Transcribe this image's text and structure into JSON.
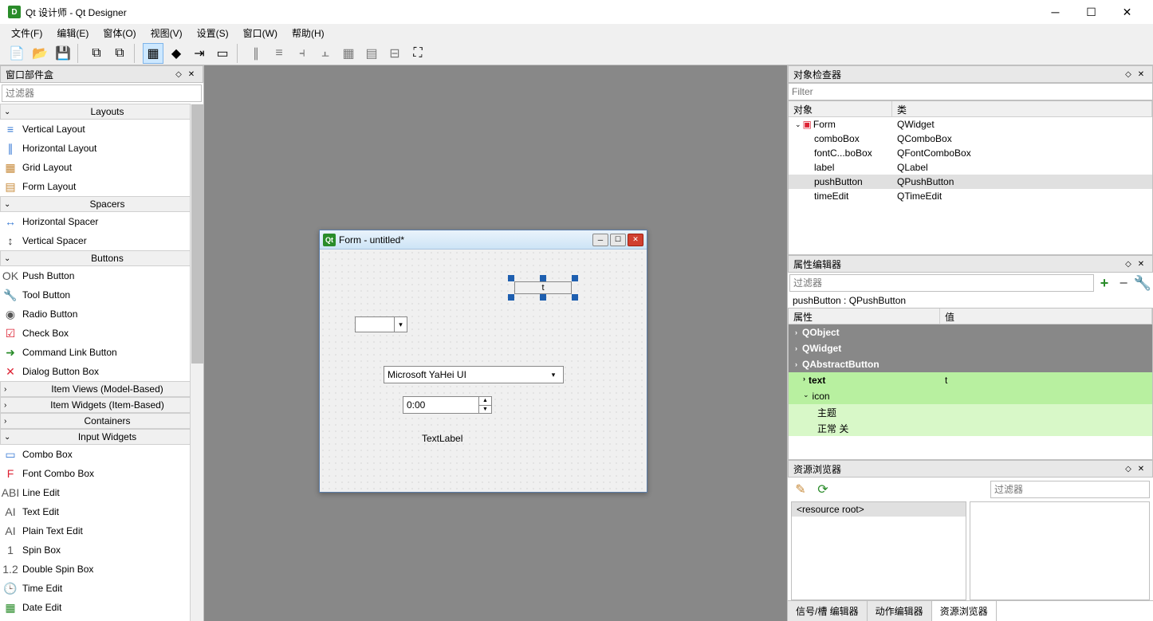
{
  "window": {
    "title": "Qt 设计师 - Qt Designer",
    "app_icon_letter": "D"
  },
  "menus": [
    "文件(F)",
    "编辑(E)",
    "窗体(O)",
    "视图(V)",
    "设置(S)",
    "窗口(W)",
    "帮助(H)"
  ],
  "widget_box": {
    "title": "窗口部件盒",
    "filter_placeholder": "过滤器",
    "groups": [
      {
        "name": "Layouts",
        "expanded": true,
        "items": [
          {
            "label": "Vertical Layout",
            "icon": "≡",
            "color": "#3a7bd5"
          },
          {
            "label": "Horizontal Layout",
            "icon": "∥",
            "color": "#3a7bd5"
          },
          {
            "label": "Grid Layout",
            "icon": "▦",
            "color": "#c78a3a"
          },
          {
            "label": "Form Layout",
            "icon": "▤",
            "color": "#c78a3a"
          }
        ]
      },
      {
        "name": "Spacers",
        "expanded": true,
        "items": [
          {
            "label": "Horizontal Spacer",
            "icon": "↔",
            "color": "#3a7bd5"
          },
          {
            "label": "Vertical Spacer",
            "icon": "↕",
            "color": "#333"
          }
        ]
      },
      {
        "name": "Buttons",
        "expanded": true,
        "items": [
          {
            "label": "Push Button",
            "icon": "OK",
            "color": "#555"
          },
          {
            "label": "Tool Button",
            "icon": "🔧",
            "color": "#555"
          },
          {
            "label": "Radio Button",
            "icon": "◉",
            "color": "#555"
          },
          {
            "label": "Check Box",
            "icon": "☑",
            "color": "#d23"
          },
          {
            "label": "Command Link Button",
            "icon": "➜",
            "color": "#2a8c2a"
          },
          {
            "label": "Dialog Button Box",
            "icon": "✕",
            "color": "#d23"
          }
        ]
      },
      {
        "name": "Item Views (Model-Based)",
        "expanded": false,
        "items": []
      },
      {
        "name": "Item Widgets (Item-Based)",
        "expanded": false,
        "items": []
      },
      {
        "name": "Containers",
        "expanded": false,
        "items": []
      },
      {
        "name": "Input Widgets",
        "expanded": true,
        "items": [
          {
            "label": "Combo Box",
            "icon": "▭",
            "color": "#3a7bd5"
          },
          {
            "label": "Font Combo Box",
            "icon": "F",
            "color": "#d23"
          },
          {
            "label": "Line Edit",
            "icon": "ABI",
            "color": "#555"
          },
          {
            "label": "Text Edit",
            "icon": "AI",
            "color": "#555"
          },
          {
            "label": "Plain Text Edit",
            "icon": "AI",
            "color": "#555"
          },
          {
            "label": "Spin Box",
            "icon": "1",
            "color": "#555"
          },
          {
            "label": "Double Spin Box",
            "icon": "1.2",
            "color": "#555"
          },
          {
            "label": "Time Edit",
            "icon": "🕒",
            "color": "#555"
          },
          {
            "label": "Date Edit",
            "icon": "▦",
            "color": "#2a8c2a"
          }
        ]
      }
    ]
  },
  "form": {
    "title": "Form - untitled*",
    "font_value": "Microsoft YaHei UI",
    "time_value": "0:00",
    "label_text": "TextLabel",
    "button_text": "t"
  },
  "inspector": {
    "title": "对象检查器",
    "filter_placeholder": "Filter",
    "headers": [
      "对象",
      "类"
    ],
    "rows": [
      {
        "name": "Form",
        "cls": "QWidget",
        "depth": 0,
        "expand": "v",
        "icon": "▣"
      },
      {
        "name": "comboBox",
        "cls": "QComboBox",
        "depth": 1
      },
      {
        "name": "fontC...boBox",
        "cls": "QFontComboBox",
        "depth": 1
      },
      {
        "name": "label",
        "cls": "QLabel",
        "depth": 1
      },
      {
        "name": "pushButton",
        "cls": "QPushButton",
        "depth": 1,
        "selected": true
      },
      {
        "name": "timeEdit",
        "cls": "QTimeEdit",
        "depth": 1
      }
    ]
  },
  "properties": {
    "title": "属性编辑器",
    "filter_placeholder": "过滤器",
    "selection": "pushButton : QPushButton",
    "headers": [
      "属性",
      "值"
    ],
    "categories": [
      "QObject",
      "QWidget",
      "QAbstractButton"
    ],
    "items": [
      {
        "name": "text",
        "value": "t",
        "bold": true,
        "sub": false
      },
      {
        "name": "icon",
        "value": "",
        "bold": false,
        "sub": false,
        "expand": "v"
      },
      {
        "name": "主题",
        "value": "",
        "sub": true
      },
      {
        "name": "正常 关",
        "value": "",
        "sub": true
      }
    ]
  },
  "resources": {
    "title": "资源浏览器",
    "filter_placeholder": "过滤器",
    "root_label": "<resource root>",
    "tabs": [
      "信号/槽 编辑器",
      "动作编辑器",
      "资源浏览器"
    ],
    "active_tab": 2
  }
}
